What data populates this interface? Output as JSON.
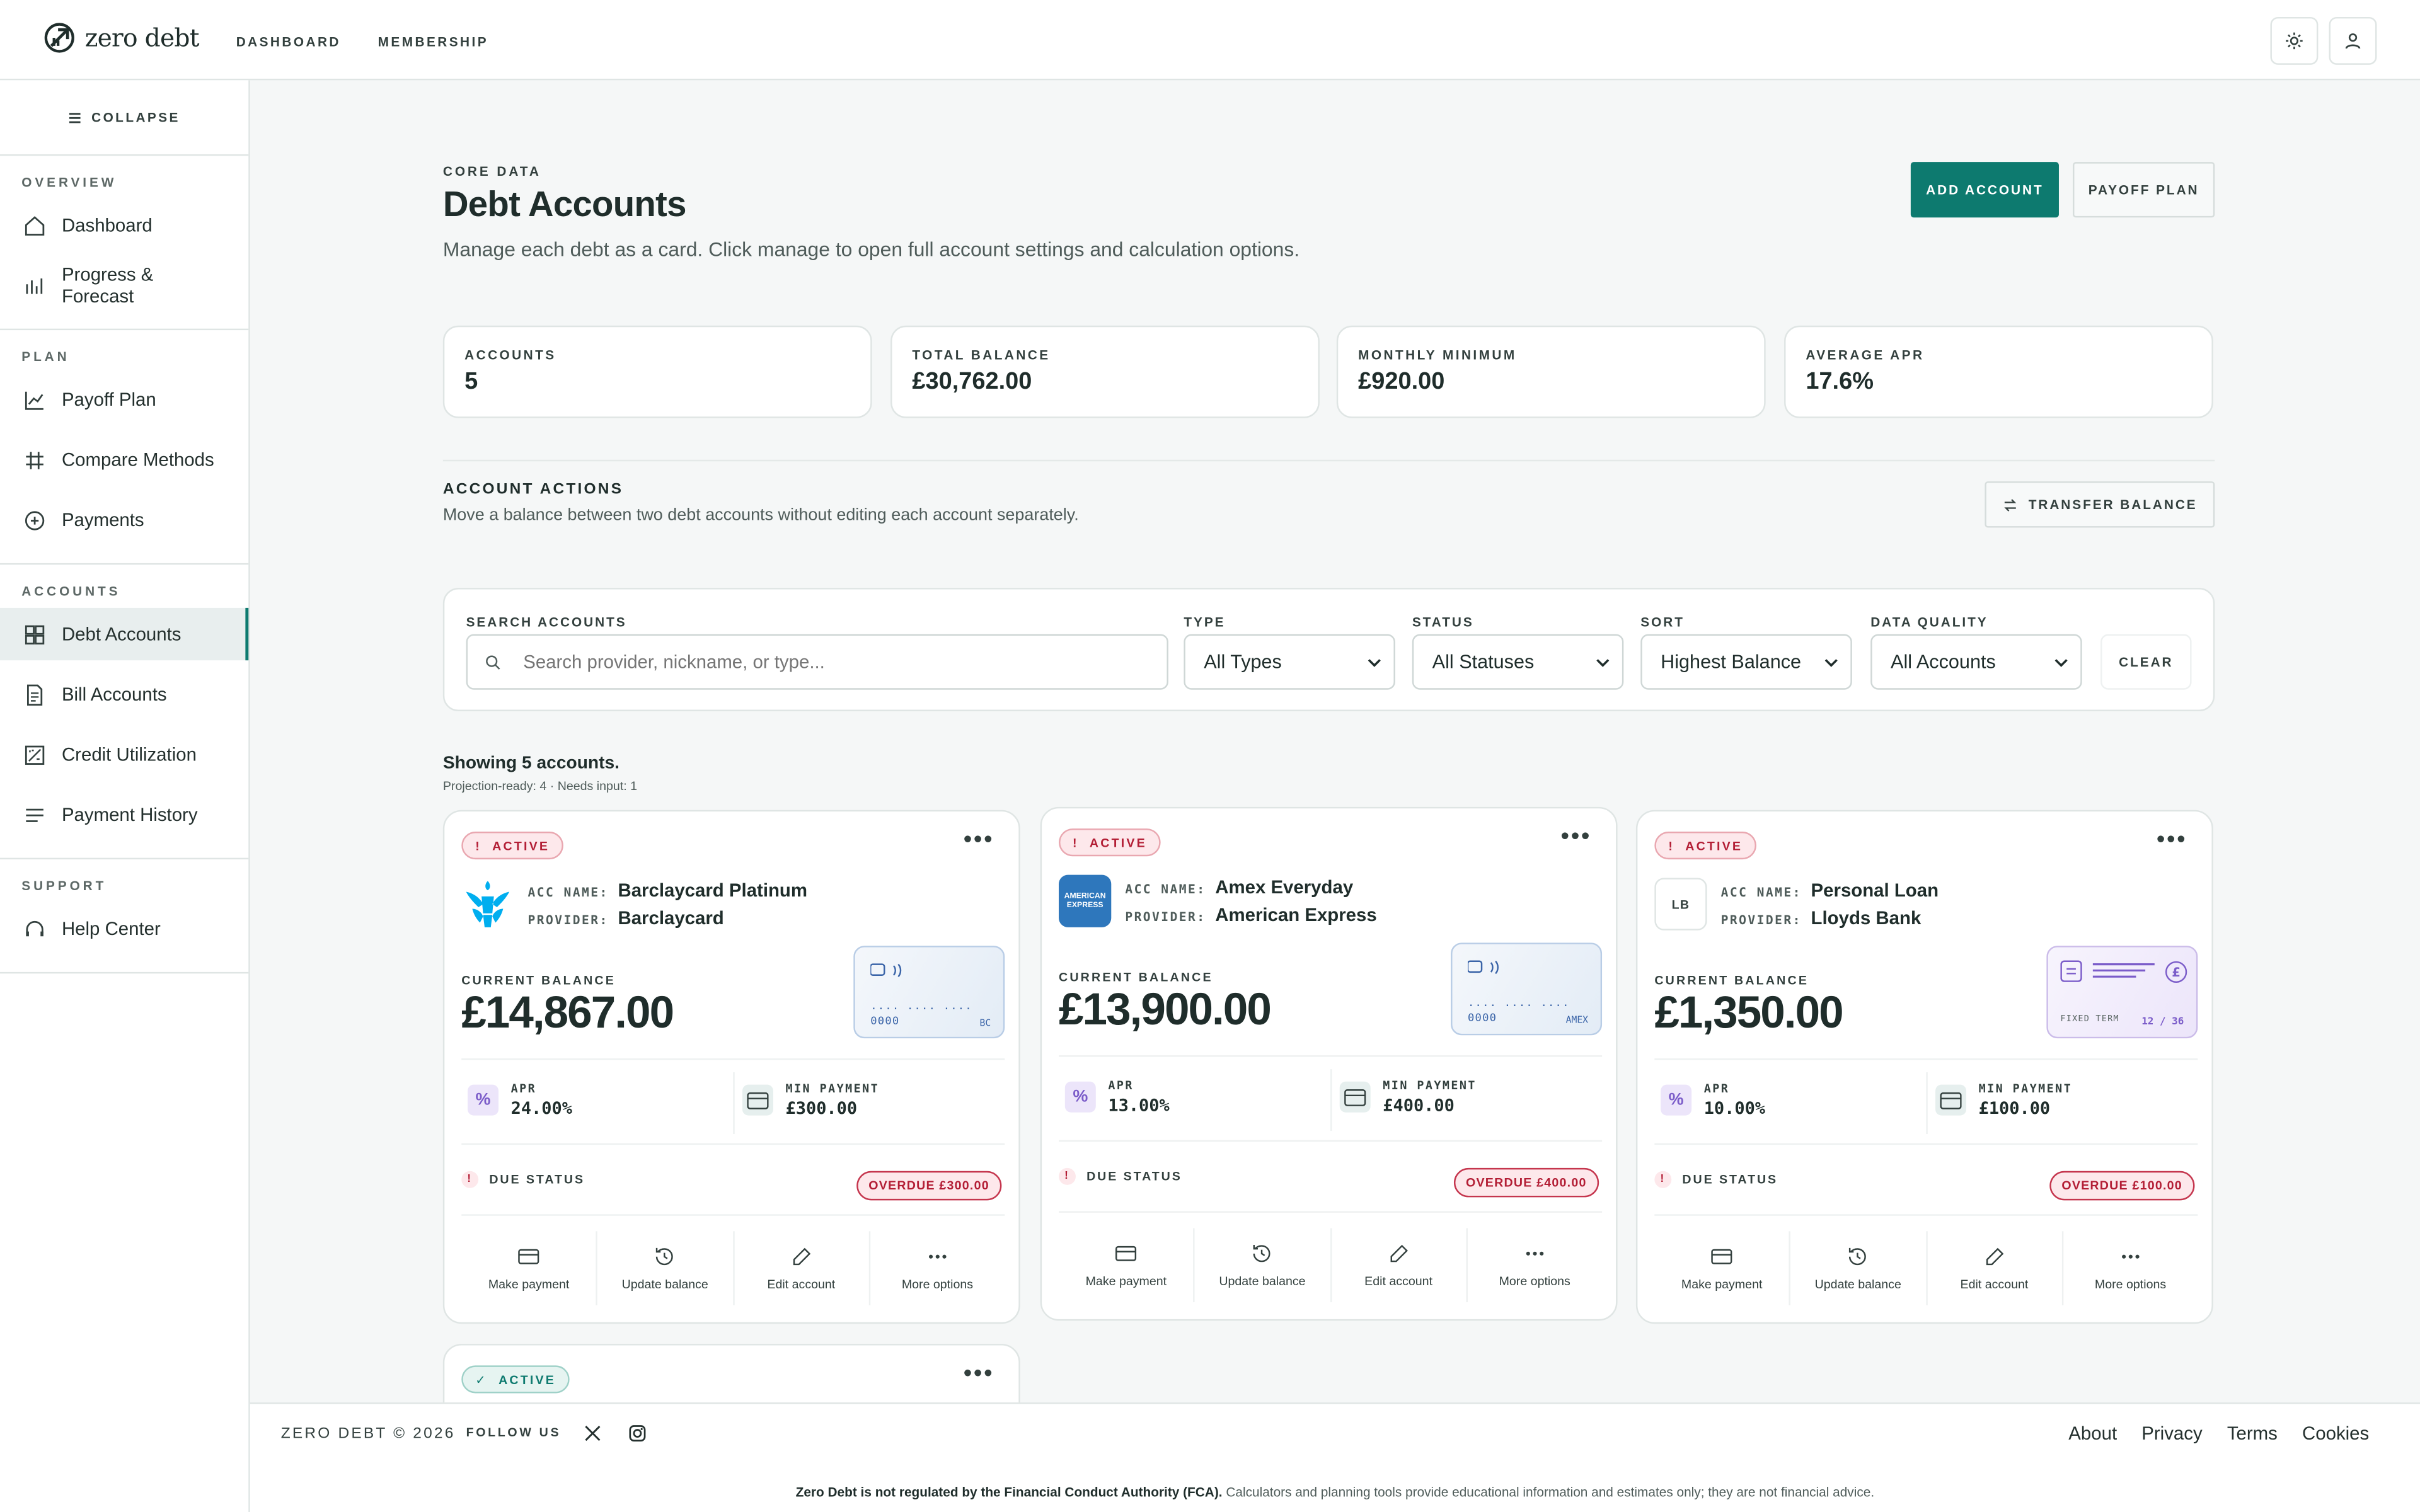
{
  "brand": {
    "name": "zero debt"
  },
  "topnav": [
    {
      "label": "DASHBOARD"
    },
    {
      "label": "MEMBERSHIP"
    }
  ],
  "header_icons": {
    "theme": "sun-icon",
    "profile": "user-icon"
  },
  "sidebar": {
    "collapse_label": "COLLAPSE",
    "sections": [
      {
        "title": "OVERVIEW",
        "items": [
          {
            "label": "Dashboard",
            "icon": "home-icon"
          },
          {
            "label": "Progress & Forecast",
            "icon": "bar-chart-icon"
          }
        ]
      },
      {
        "title": "PLAN",
        "items": [
          {
            "label": "Payoff Plan",
            "icon": "line-chart-icon"
          },
          {
            "label": "Compare Methods",
            "icon": "compare-icon"
          },
          {
            "label": "Payments",
            "icon": "plus-circle-icon"
          }
        ]
      },
      {
        "title": "ACCOUNTS",
        "items": [
          {
            "label": "Debt Accounts",
            "icon": "grid-icon",
            "active": true
          },
          {
            "label": "Bill Accounts",
            "icon": "document-icon"
          },
          {
            "label": "Credit Utilization",
            "icon": "utilization-icon"
          },
          {
            "label": "Payment History",
            "icon": "list-icon"
          }
        ]
      },
      {
        "title": "SUPPORT",
        "items": [
          {
            "label": "Help Center",
            "icon": "headset-icon"
          }
        ]
      }
    ]
  },
  "page": {
    "kicker": "CORE DATA",
    "title": "Debt Accounts",
    "subtitle": "Manage each debt as a card. Click manage to open full account settings and calculation options.",
    "add_account": "ADD ACCOUNT",
    "payoff_plan": "PAYOFF PLAN"
  },
  "stats": [
    {
      "label": "ACCOUNTS",
      "value": "5"
    },
    {
      "label": "TOTAL BALANCE",
      "value": "£30,762.00"
    },
    {
      "label": "MONTHLY MINIMUM",
      "value": "£920.00"
    },
    {
      "label": "AVERAGE APR",
      "value": "17.6%"
    }
  ],
  "account_actions": {
    "title": "ACCOUNT ACTIONS",
    "subtitle": "Move a balance between two debt accounts without editing each account separately.",
    "transfer_label": "TRANSFER BALANCE"
  },
  "filters": {
    "search_label": "SEARCH ACCOUNTS",
    "search_placeholder": "Search provider, nickname, or type...",
    "type_label": "TYPE",
    "type_value": "All Types",
    "status_label": "STATUS",
    "status_value": "All Statuses",
    "sort_label": "SORT",
    "sort_value": "Highest Balance",
    "quality_label": "DATA QUALITY",
    "quality_value": "All Accounts",
    "clear_label": "CLEAR"
  },
  "results": {
    "showing": "Showing 5 accounts.",
    "sub": "Projection-ready: 4 · Needs input: 1"
  },
  "card_labels": {
    "acc_name": "ACC NAME:",
    "provider": "PROVIDER:",
    "current_balance": "CURRENT BALANCE",
    "apr": "APR",
    "min_payment": "MIN PAYMENT",
    "due_status": "DUE STATUS",
    "make_payment": "Make payment",
    "update_balance": "Update balance",
    "edit_account": "Edit account",
    "more_options": "More options"
  },
  "cards": [
    {
      "status": "ACTIVE",
      "name": "Barclaycard Platinum",
      "provider": "Barclaycard",
      "balance": "£14,867.00",
      "apr": "24.00%",
      "min": "£300.00",
      "overdue": "OVERDUE £300.00",
      "card_dots": "···· ···· ···· 0000",
      "card_tag": "BC",
      "logo": "eagle-logo"
    },
    {
      "status": "ACTIVE",
      "name": "Amex Everyday",
      "provider": "American Express",
      "balance": "£13,900.00",
      "apr": "13.00%",
      "min": "£400.00",
      "overdue": "OVERDUE £400.00",
      "card_dots": "···· ···· ···· 0000",
      "card_tag": "AMEX",
      "logo_text": "AMERICAN EXPRESS"
    },
    {
      "status": "ACTIVE",
      "name": "Personal Loan",
      "provider": "Lloyds Bank",
      "balance": "£1,350.00",
      "apr": "10.00%",
      "min": "£100.00",
      "overdue": "OVERDUE £100.00",
      "term_label": "FIXED TERM",
      "term_value": "12 / 36",
      "logo_text": "LB"
    },
    {
      "status": "ACTIVE"
    }
  ],
  "footer": {
    "copyright": "ZERO DEBT © 2026",
    "follow": "FOLLOW US",
    "links": [
      "About",
      "Privacy",
      "Terms",
      "Cookies"
    ],
    "disclaimer_bold": "Zero Debt is not regulated by the Financial Conduct Authority (FCA).",
    "disclaimer": "Calculators and planning tools provide educational information and estimates only; they are not financial advice."
  },
  "colors": {
    "accent": "#0d7a6f",
    "danger": "#b31e35",
    "amex": "#2e77bc",
    "barclays": "#00aeef",
    "term": "#7b5cc9"
  }
}
